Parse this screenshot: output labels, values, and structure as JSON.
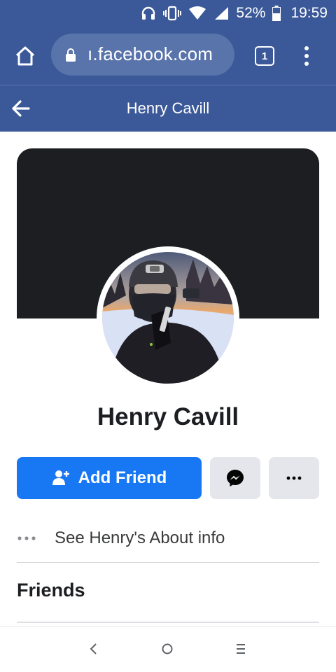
{
  "status_bar": {
    "battery": "52%",
    "time": "19:59"
  },
  "browser": {
    "url": "ı.facebook.com",
    "tab_count": "1"
  },
  "header": {
    "title": "Henry Cavill"
  },
  "profile": {
    "name": "Henry Cavill",
    "add_friend_label": "Add Friend",
    "about_label": "See Henry's About info",
    "friends_title": "Friends"
  },
  "colors": {
    "brand": "#3b5998",
    "primary_button": "#1877f2",
    "secondary_button": "#e4e6eb"
  }
}
